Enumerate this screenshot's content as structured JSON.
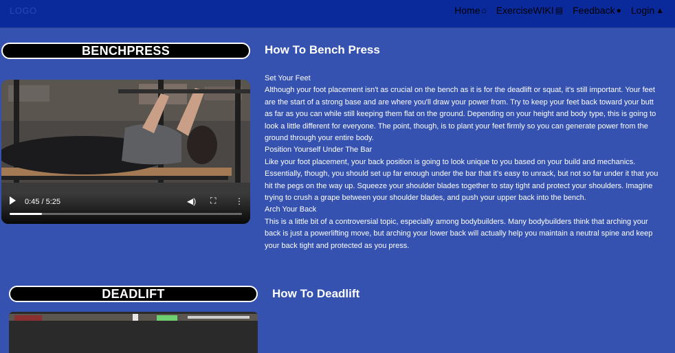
{
  "navbar": {
    "logo": "LOGO",
    "links": [
      {
        "label": "Home",
        "icon": "home-icon",
        "glyph": "⌂"
      },
      {
        "label": "ExerciseWIKI",
        "icon": "book-icon",
        "glyph": "▤"
      },
      {
        "label": "Feedback",
        "icon": "comment-icon",
        "glyph": "●"
      },
      {
        "label": "Login",
        "icon": "user-icon",
        "glyph": "▲"
      }
    ]
  },
  "exercises": [
    {
      "name": "BENCHPRESS",
      "heading": "How To Bench Press",
      "video": {
        "time": "0:45 / 5:25",
        "progress": 0.14
      },
      "paragraphs": [
        "Set Your Feet",
        "Although your foot placement isn't as crucial on the bench as it is for the deadlift or squat, it's still important. Your feet are the start of a strong base and are where you'll draw your power from. Try to keep your feet back toward your butt as far as you can while still keeping them flat on the ground. Depending on your height and body type, this is going to look a little different for everyone. The point, though, is to plant your feet firmly so you can generate power from the ground through your entire body.",
        "Position Yourself Under The Bar",
        "Like your foot placement, your back position is going to look unique to you based on your build and mechanics. Essentially, though, you should set up far enough under the bar that it's easy to unrack, but not so far under it that you hit the pegs on the way up. Squeeze your shoulder blades together to stay tight and protect your shoulders. Imagine trying to crush a grape between your shoulder blades, and push your upper back into the bench.",
        "Arch Your Back",
        "This is a little bit of a controversial topic, especially among bodybuilders. Many bodybuilders think that arching your back is just a powerlifting move, but arching your lower back will actually help you maintain a neutral spine and keep your back tight and protected as you press."
      ]
    },
    {
      "name": "DEADLIFT",
      "heading": "How To Deadlift"
    }
  ],
  "colors": {
    "page_bg": "#3552b0",
    "navbar_bg": "#0a2a9c"
  }
}
